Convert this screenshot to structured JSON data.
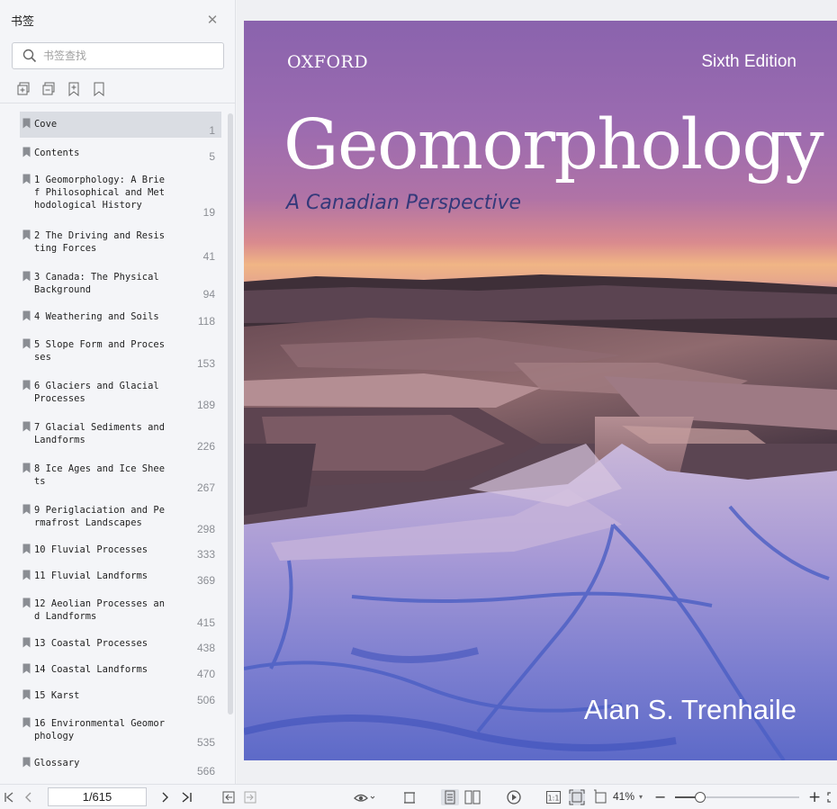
{
  "sidebar": {
    "title": "书签",
    "search_placeholder": "书签查找",
    "tools": [
      "expand-all-icon",
      "collapse-all-icon",
      "add-bookmark-icon",
      "bookmark-icon"
    ],
    "bookmarks": [
      {
        "label": "Cove",
        "page": "1",
        "active": true
      },
      {
        "label": "Contents",
        "page": "5"
      },
      {
        "label": "1  Geomorphology: A Brief Philosophical and Methodological History",
        "page": "19"
      },
      {
        "label": "2  The Driving and Resisting Forces",
        "page": "41"
      },
      {
        "label": "3  Canada: The Physical Background",
        "page": "94"
      },
      {
        "label": "4  Weathering and Soils",
        "page": "118"
      },
      {
        "label": "5  Slope Form and Processes",
        "page": "153"
      },
      {
        "label": "6  Glaciers and Glacial Processes",
        "page": "189"
      },
      {
        "label": "7  Glacial Sediments and Landforms",
        "page": "226"
      },
      {
        "label": "8  Ice Ages and Ice Sheets",
        "page": "267"
      },
      {
        "label": "9  Periglaciation and Permafrost Landscapes",
        "page": "298"
      },
      {
        "label": "10  Fluvial Processes",
        "page": "333"
      },
      {
        "label": "11  Fluvial Landforms",
        "page": "369"
      },
      {
        "label": "12  Aeolian Processes and Landforms",
        "page": "415"
      },
      {
        "label": "13  Coastal Processes",
        "page": "438"
      },
      {
        "label": "14  Coastal Landforms",
        "page": "470"
      },
      {
        "label": "15  Karst",
        "page": "506"
      },
      {
        "label": "16  Environmental Geomorphology",
        "page": "535"
      },
      {
        "label": "Glossary",
        "page": "566"
      }
    ]
  },
  "cover": {
    "publisher": "OXFORD",
    "edition": "Sixth Edition",
    "title": "Geomorphology",
    "subtitle": "A Canadian Perspective",
    "author": "Alan S. Trenhaile"
  },
  "toolbar": {
    "page_indicator": "1/615",
    "zoom": "41%",
    "zoom_fraction": 0.2
  }
}
